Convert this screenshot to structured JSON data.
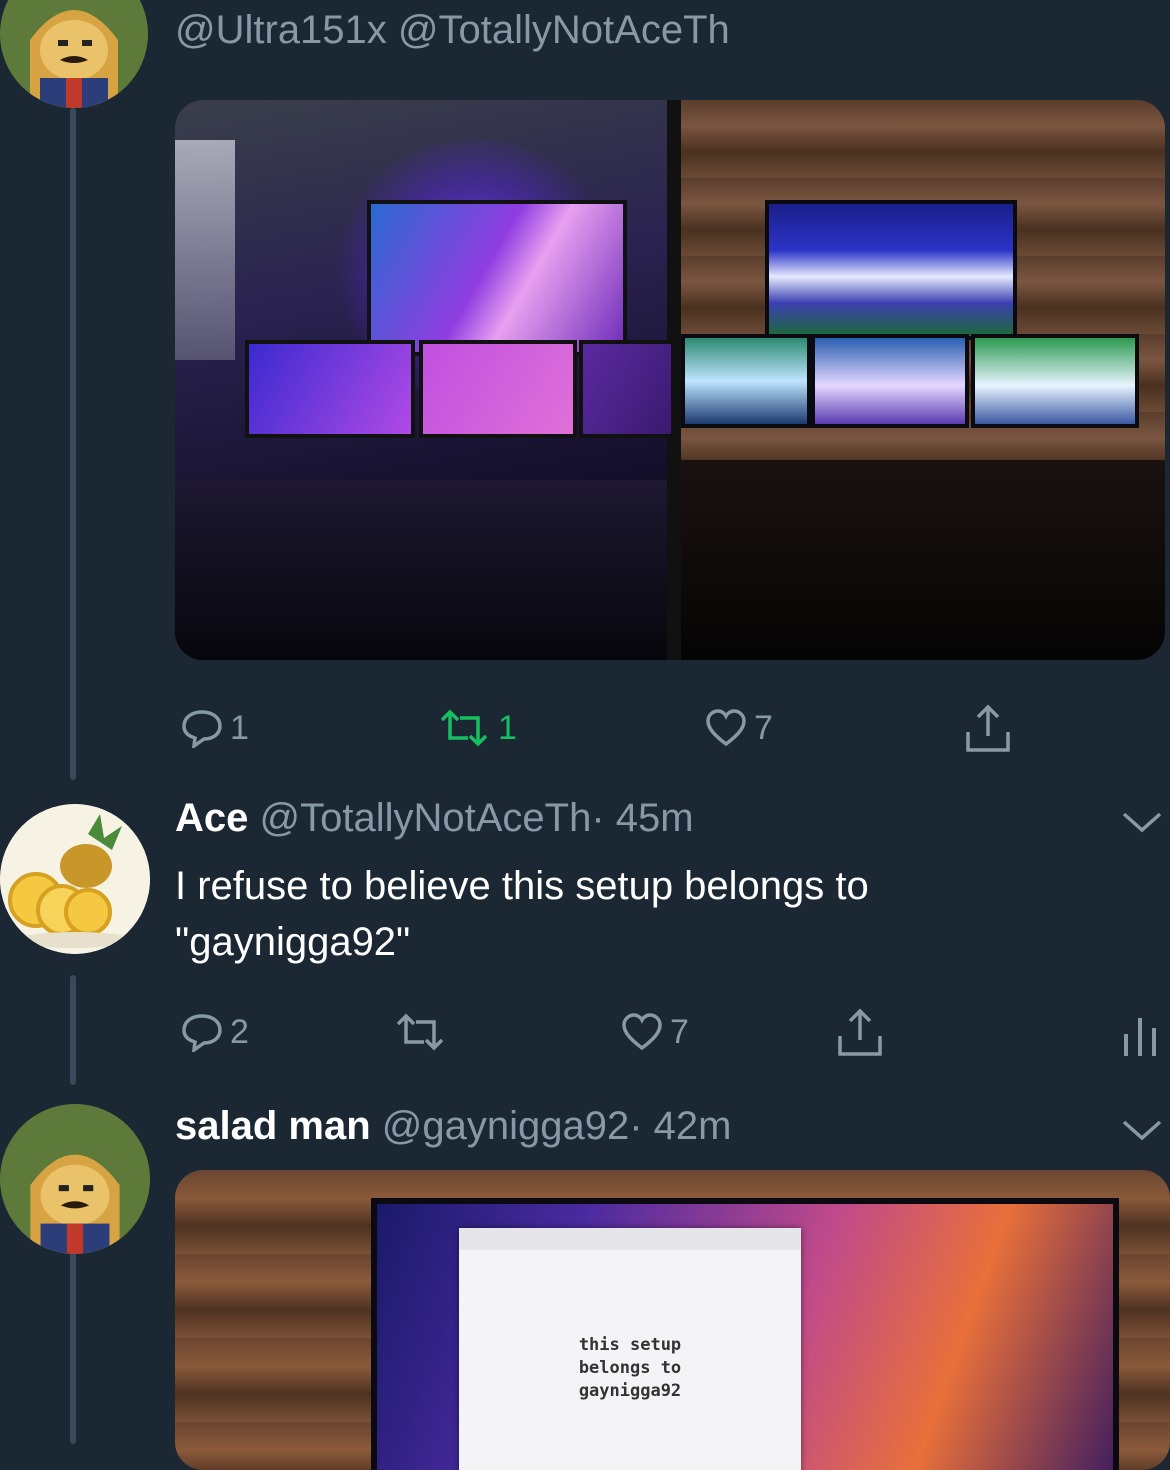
{
  "tweet1": {
    "replying_to": "@Ultra151x @TotallyNotAceTh",
    "actions": {
      "replies": "1",
      "retweets": "1",
      "likes": "7"
    }
  },
  "tweet2": {
    "name": "Ace",
    "handle": "@TotallyNotAceTh",
    "time": "· 45m",
    "text": "I refuse to believe this setup belongs to\n\"gaynigga92\"",
    "actions": {
      "replies": "2",
      "likes": "7"
    }
  },
  "tweet3": {
    "name": "salad man",
    "handle": "@gaynigga92",
    "time": "· 42m",
    "photo_note": "this setup\nbelongs to\ngaynigga92"
  },
  "colors": {
    "background": "#1b2733",
    "muted": "#8899a6",
    "retweet_active": "#17bf63"
  },
  "icons": [
    "reply-icon",
    "retweet-icon",
    "like-icon",
    "share-icon",
    "chevron-down-icon",
    "analytics-icon"
  ]
}
